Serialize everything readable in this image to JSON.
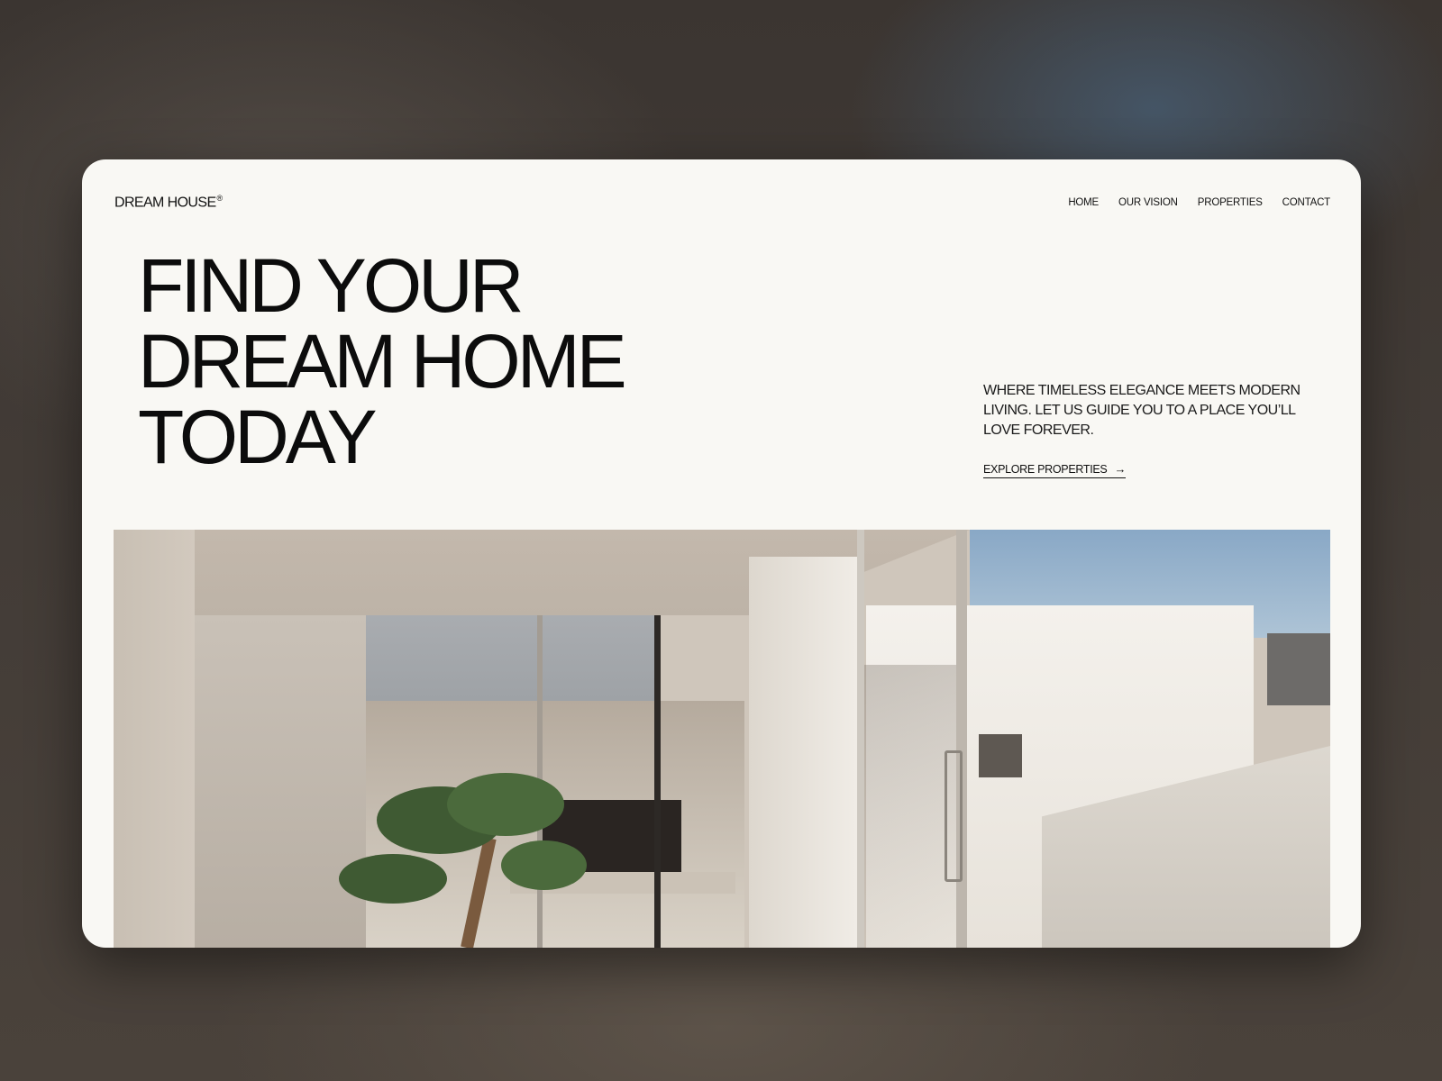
{
  "brand": {
    "name": "DREAM HOUSE",
    "mark": "®"
  },
  "nav": {
    "items": [
      {
        "label": "HOME"
      },
      {
        "label": "OUR VISION"
      },
      {
        "label": "PROPERTIES"
      },
      {
        "label": "CONTACT"
      }
    ]
  },
  "hero": {
    "title_lines": [
      "FIND YOUR",
      "DREAM HOME",
      "TODAY"
    ],
    "tagline": "WHERE TIMELESS ELEGANCE MEETS MODERN LIVING. LET US GUIDE YOU TO A PLACE YOU’LL LOVE FOREVER.",
    "cta_label": "EXPLORE PROPERTIES",
    "cta_icon": "arrow-right-icon"
  },
  "colors": {
    "card_bg": "#f9f8f4",
    "text": "#0c0c0c",
    "backdrop": "#3a3532"
  }
}
